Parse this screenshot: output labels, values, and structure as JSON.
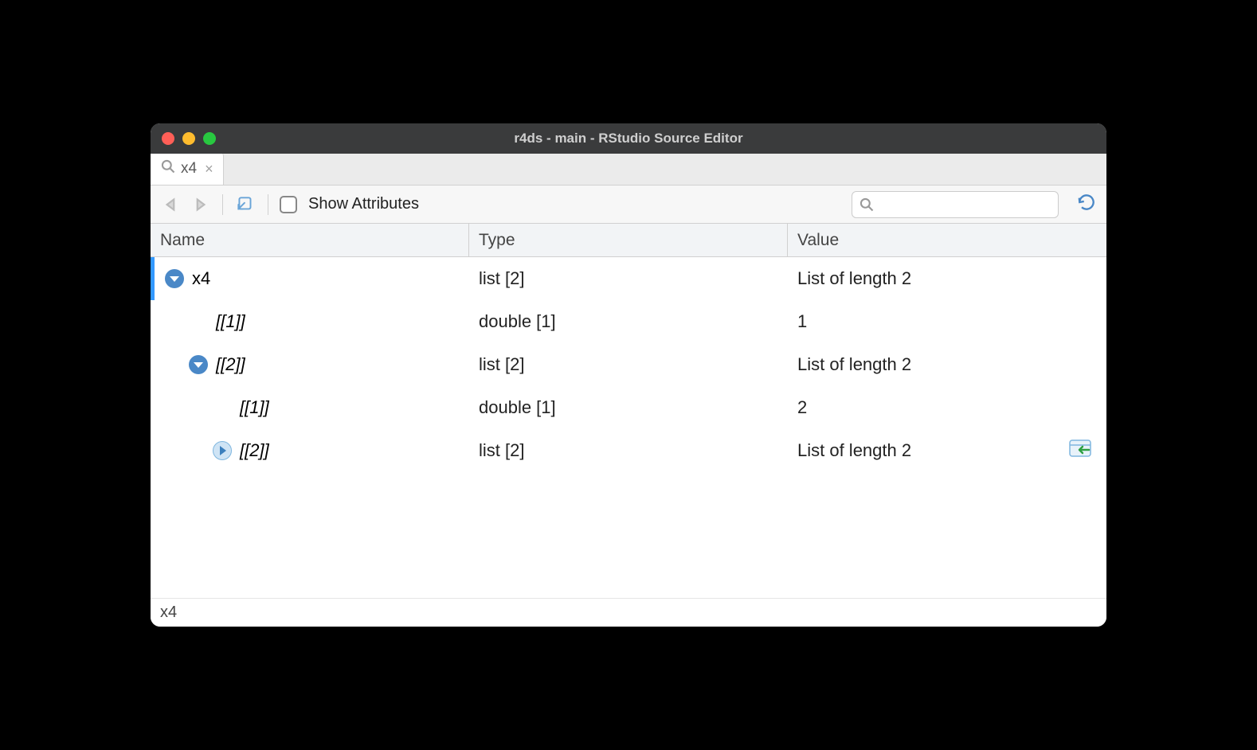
{
  "window": {
    "title": "r4ds - main - RStudio Source Editor"
  },
  "tab": {
    "label": "x4"
  },
  "toolbar": {
    "show_attributes": "Show Attributes",
    "search_placeholder": ""
  },
  "columns": {
    "name": "Name",
    "type": "Type",
    "value": "Value"
  },
  "rows": [
    {
      "indent": 0,
      "toggle": "down",
      "name": "x4",
      "italic": false,
      "type": "list [2]",
      "value": "List of length 2",
      "selected": true,
      "action": false
    },
    {
      "indent": 1,
      "toggle": "none",
      "name": "[[1]]",
      "italic": true,
      "type": "double [1]",
      "value": "1",
      "selected": false,
      "action": false
    },
    {
      "indent": 1,
      "toggle": "down",
      "name": "[[2]]",
      "italic": true,
      "type": "list [2]",
      "value": "List of length 2",
      "selected": false,
      "action": false
    },
    {
      "indent": 2,
      "toggle": "none",
      "name": "[[1]]",
      "italic": true,
      "type": "double [1]",
      "value": "2",
      "selected": false,
      "action": false
    },
    {
      "indent": 2,
      "toggle": "right",
      "name": "[[2]]",
      "italic": true,
      "type": "list [2]",
      "value": "List of length 2",
      "selected": false,
      "action": true
    }
  ],
  "statusbar": {
    "path": "x4"
  }
}
